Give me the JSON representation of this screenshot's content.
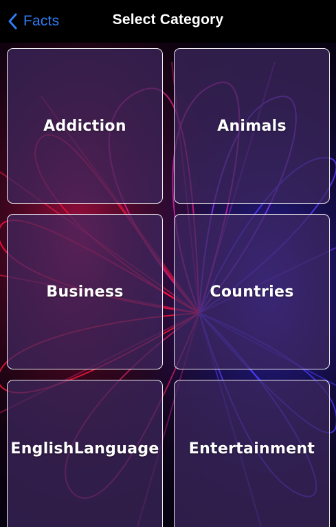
{
  "navbar": {
    "back_label": "Facts",
    "title": "Select Category"
  },
  "categories": [
    {
      "label": "Addiction"
    },
    {
      "label": "Animals"
    },
    {
      "label": "Business"
    },
    {
      "label": "Countries"
    },
    {
      "label": "EnglishLanguage"
    },
    {
      "label": "Entertainment"
    }
  ],
  "colors": {
    "accent": "#2f7cf6",
    "tile_fill": "#3e2860",
    "tile_border": "#ffffff",
    "background": "#000000",
    "swirl_red": "#e8123c",
    "swirl_magenta": "#c0208a",
    "swirl_blue": "#4a3cff"
  },
  "icons": {
    "back": "chevron-left-icon"
  }
}
